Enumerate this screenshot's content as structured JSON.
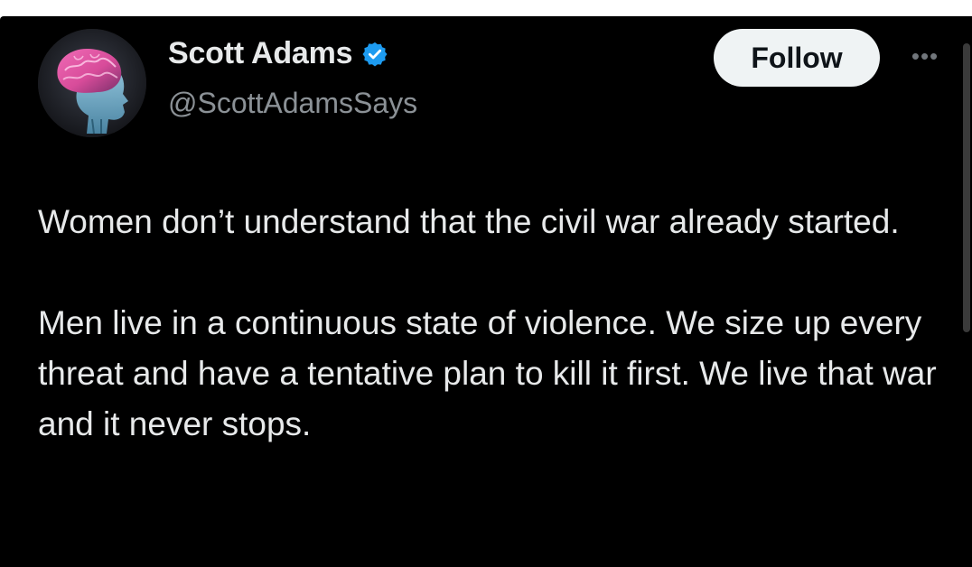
{
  "tweet": {
    "author": {
      "display_name": "Scott Adams",
      "handle": "@ScottAdamsSays",
      "verified": true,
      "avatar_icon": "brain-profile-avatar"
    },
    "follow_label": "Follow",
    "more_label": "•••",
    "paragraphs": [
      "Women don’t understand that the civil war already started.",
      "Men live in a continuous state of violence. We size up every threat and have a tentative plan to kill it first. We live that war and it never stops."
    ]
  },
  "colors": {
    "background": "#000000",
    "text": "#e7e9ea",
    "secondary_text": "#8b9196",
    "verified_badge": "#1d9bf0",
    "follow_button_bg": "#eff3f4",
    "follow_button_text": "#0f1419"
  }
}
